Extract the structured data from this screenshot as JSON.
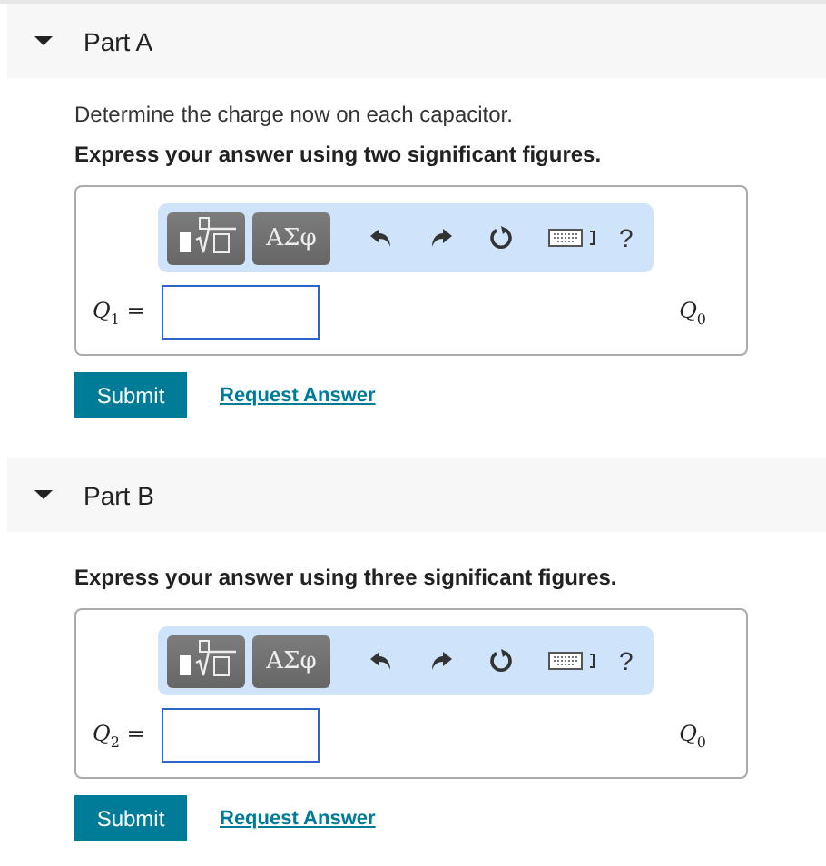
{
  "parts": [
    {
      "title": "Part A",
      "expanded": true,
      "instructions": [
        "Determine the charge now on each capacitor."
      ],
      "emphasis": "Express your answer using two significant figures.",
      "toolbar": {
        "symbols": "ΑΣφ",
        "help": "?"
      },
      "label": "*Q*$_{1}$ =",
      "units": "*Q*$_{0}$",
      "submit": "Submit",
      "request": "Request Answer"
    },
    {
      "title": "Part B",
      "expanded": true,
      "emphasis": "Express your answer using three significant figures.",
      "toolbar": {
        "symbols": "ΑΣφ",
        "help": "?"
      },
      "label": "*Q*$_{2}$ =",
      "units": "*Q*$_{0}$",
      "submit": "Submit",
      "request": "Request Answer"
    }
  ]
}
